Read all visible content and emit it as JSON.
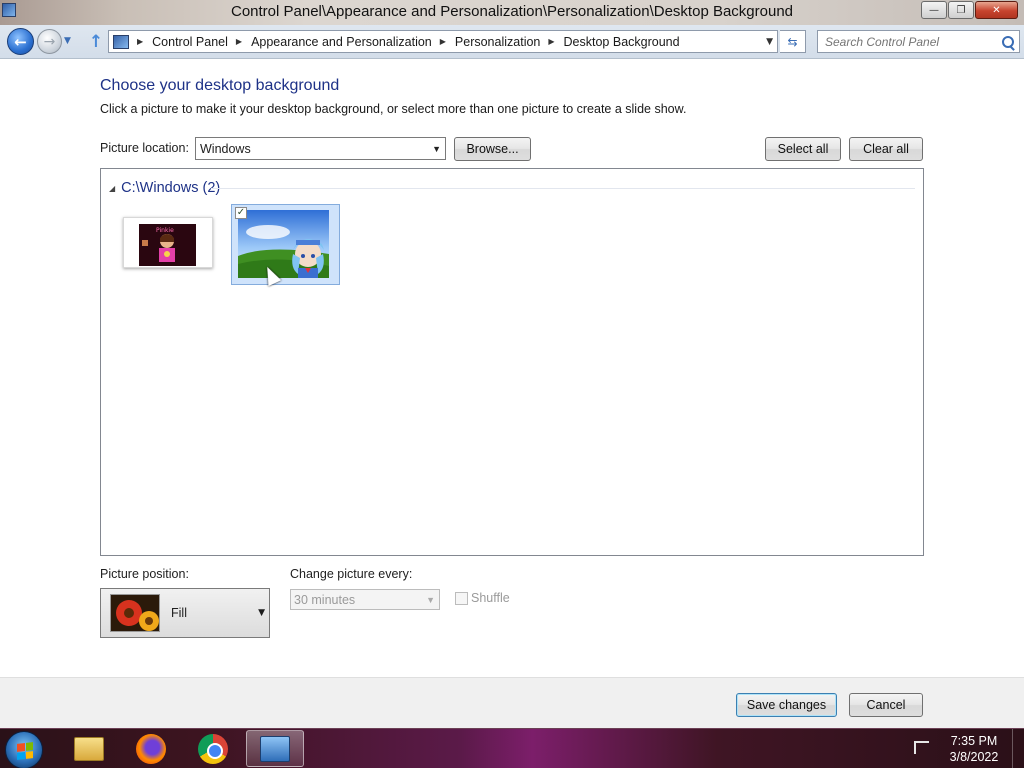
{
  "window": {
    "title": "Control Panel\\Appearance and Personalization\\Personalization\\Desktop Background",
    "minimize_glyph": "—",
    "maximize_glyph": "❐",
    "close_glyph": "✕"
  },
  "nav": {
    "back_glyph": "←",
    "forward_glyph": "→",
    "breadcrumbs": [
      "Control Panel",
      "Appearance and Personalization",
      "Personalization",
      "Desktop Background"
    ],
    "search_placeholder": "Search Control Panel"
  },
  "main": {
    "heading": "Choose your desktop background",
    "subtext": "Click a picture to make it your desktop background, or select more than one picture to create a slide show.",
    "picture_location_label": "Picture location:",
    "picture_location_value": "Windows",
    "browse_label": "Browse...",
    "select_all_label": "Select all",
    "clear_all_label": "Clear all",
    "group_name": "C:\\Windows (2)",
    "pictures": [
      {
        "name": "pink-character-wallpaper",
        "selected": false
      },
      {
        "name": "bliss-anime-wallpaper",
        "selected": true
      }
    ],
    "picture_position_label": "Picture position:",
    "picture_position_value": "Fill",
    "change_every_label": "Change picture every:",
    "change_every_value": "30 minutes",
    "shuffle_label": "Shuffle"
  },
  "footer": {
    "save_label": "Save changes",
    "cancel_label": "Cancel"
  },
  "taskbar": {
    "apps": [
      "windows-explorer",
      "firefox",
      "chrome",
      "control-panel"
    ],
    "time": "7:35 PM",
    "date": "3/8/2022"
  }
}
